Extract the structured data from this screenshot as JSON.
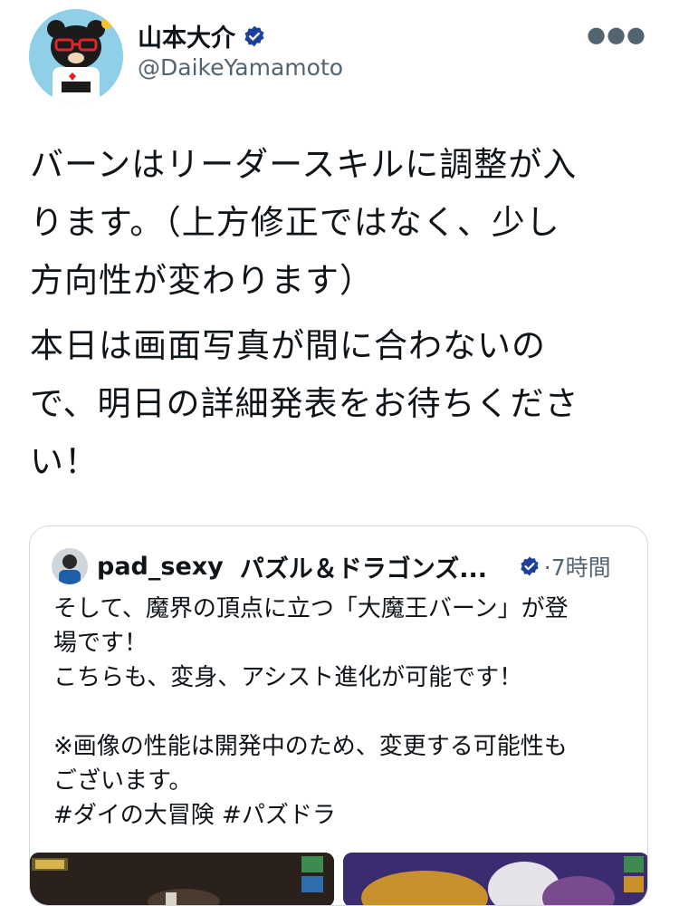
{
  "author": {
    "name": "山本大介",
    "handle": "@DaikeYamamoto"
  },
  "post": {
    "paragraph1": "バーンはリーダースキルに調整が入\nります。（上方修正ではなく、少し\n方向性が変わります）",
    "paragraph2": "本日は画面写真が間に合わないの\nで、明日の詳細発表をお待ちくださ\nい！"
  },
  "quoted": {
    "username": "pad_sexy",
    "display_name": "パズル＆ドラゴンズ...",
    "time": "·7時間",
    "text": "そして、魔界の頂点に立つ「大魔王バーン」が登\n場です！\nこちらも、変身、アシスト進化が可能です！\n\n※画像の性能は開発中のため、変更する可能性も\nございます。\n#ダイの大冒険 #パズドラ"
  },
  "icons": {
    "more": "more-icon",
    "verified": "verified-badge-icon"
  },
  "colors": {
    "verified": "#1d9bf0",
    "secondary_text": "#536471",
    "border": "#cfd9de"
  }
}
